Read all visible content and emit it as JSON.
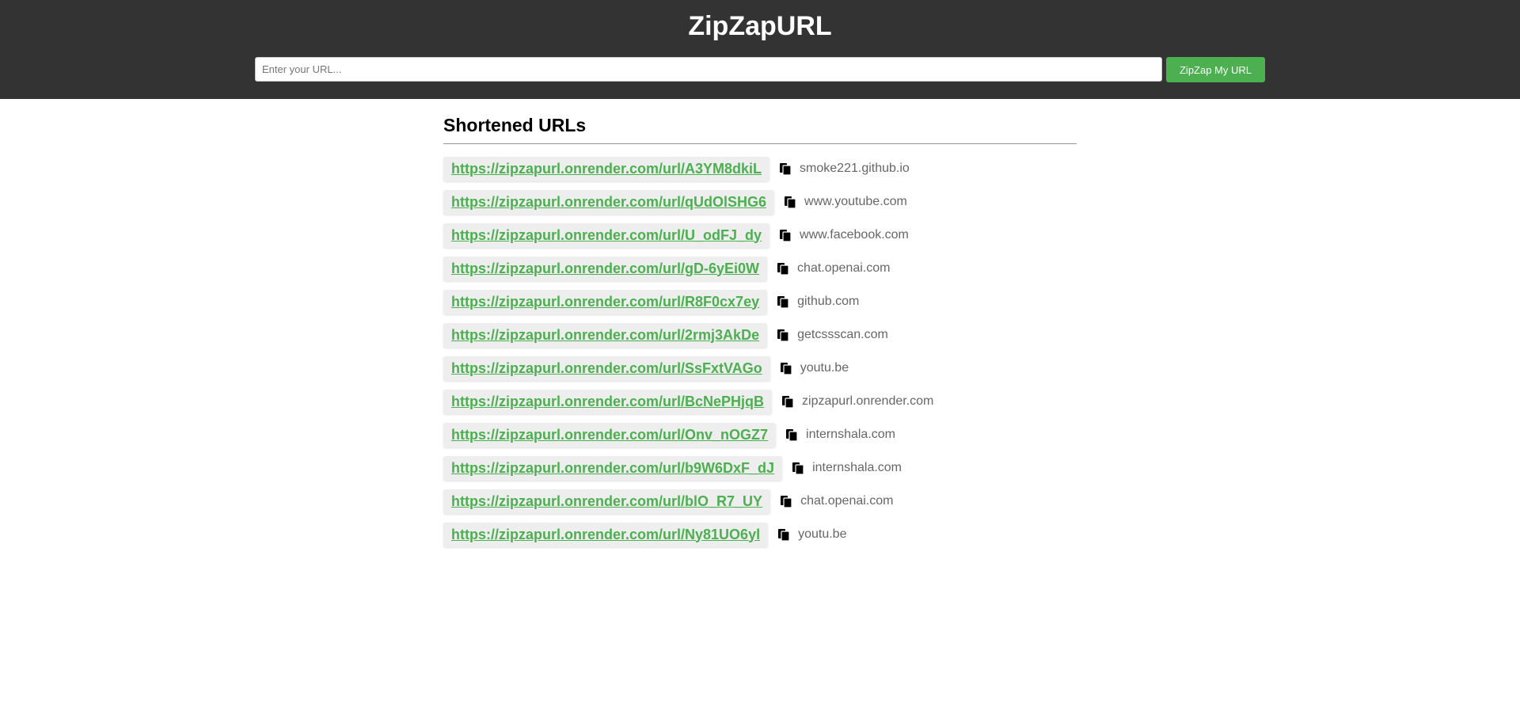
{
  "header": {
    "title": "ZipZapURL",
    "input_placeholder": "Enter your URL...",
    "input_value": "",
    "submit_label": "ZipZap My URL"
  },
  "main": {
    "section_title": "Shortened URLs",
    "items": [
      {
        "short_url": "https://zipzapurl.onrender.com/url/A3YM8dkiL",
        "domain": "smoke221.github.io"
      },
      {
        "short_url": "https://zipzapurl.onrender.com/url/qUdOlSHG6",
        "domain": "www.youtube.com"
      },
      {
        "short_url": "https://zipzapurl.onrender.com/url/U_odFJ_dy",
        "domain": "www.facebook.com"
      },
      {
        "short_url": "https://zipzapurl.onrender.com/url/gD-6yEi0W",
        "domain": "chat.openai.com"
      },
      {
        "short_url": "https://zipzapurl.onrender.com/url/R8F0cx7ey",
        "domain": "github.com"
      },
      {
        "short_url": "https://zipzapurl.onrender.com/url/2rmj3AkDe",
        "domain": "getcssscan.com"
      },
      {
        "short_url": "https://zipzapurl.onrender.com/url/SsFxtVAGo",
        "domain": "youtu.be"
      },
      {
        "short_url": "https://zipzapurl.onrender.com/url/BcNePHjqB",
        "domain": "zipzapurl.onrender.com"
      },
      {
        "short_url": "https://zipzapurl.onrender.com/url/Onv_nOGZ7",
        "domain": "internshala.com"
      },
      {
        "short_url": "https://zipzapurl.onrender.com/url/b9W6DxF_dJ",
        "domain": "internshala.com"
      },
      {
        "short_url": "https://zipzapurl.onrender.com/url/blO_R7_UY",
        "domain": "chat.openai.com"
      },
      {
        "short_url": "https://zipzapurl.onrender.com/url/Ny81UO6yl",
        "domain": "youtu.be"
      }
    ]
  },
  "icons": {
    "copy": "copy-icon"
  },
  "colors": {
    "header_bg": "#333333",
    "accent": "#4caf50",
    "domain_text": "#666666"
  }
}
